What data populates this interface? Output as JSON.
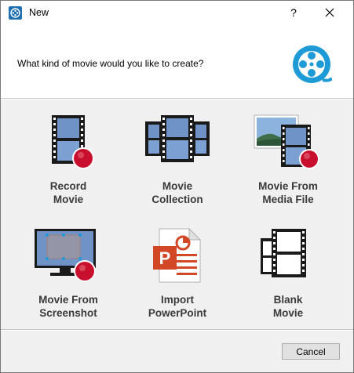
{
  "window": {
    "title": "New",
    "help_label": "?",
    "close_label": "✕"
  },
  "header": {
    "question": "What kind of movie would you like to create?"
  },
  "options": [
    {
      "label": "Record\nMovie",
      "icon": "record-movie-icon"
    },
    {
      "label": "Movie\nCollection",
      "icon": "movie-collection-icon"
    },
    {
      "label": "Movie From\nMedia File",
      "icon": "media-file-icon"
    },
    {
      "label": "Movie From\nScreenshot",
      "icon": "screenshot-icon"
    },
    {
      "label": "Import\nPowerPoint",
      "icon": "powerpoint-icon"
    },
    {
      "label": "Blank\nMovie",
      "icon": "blank-movie-icon"
    }
  ],
  "footer": {
    "cancel_label": "Cancel"
  },
  "colors": {
    "accent": "#1e9ad6",
    "record_red": "#c8102e",
    "powerpoint_orange": "#d24726"
  }
}
